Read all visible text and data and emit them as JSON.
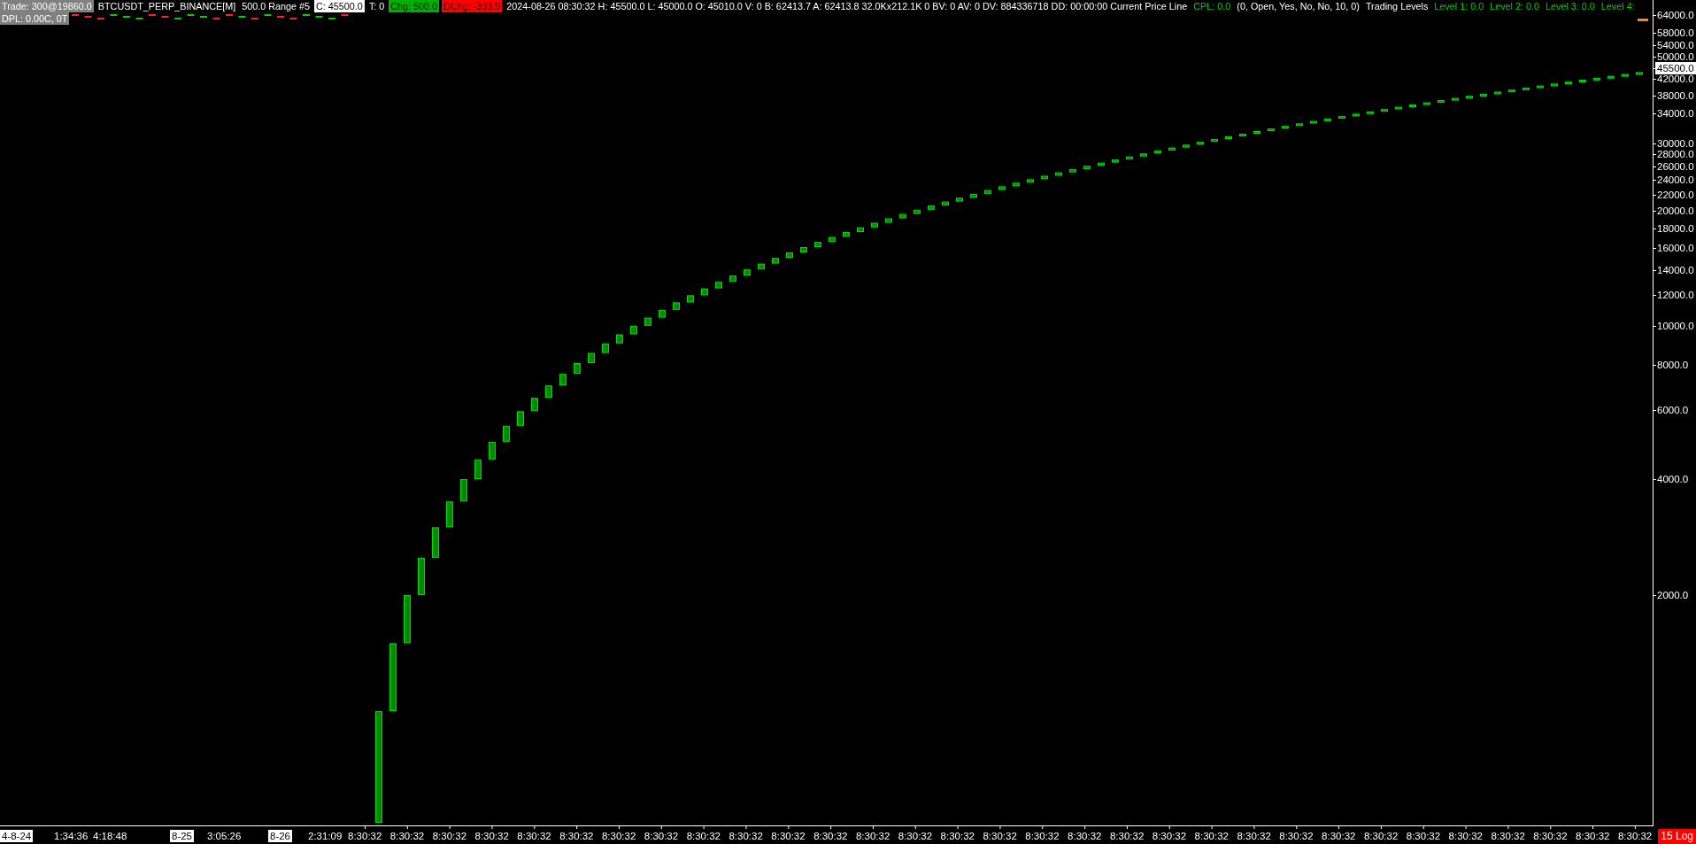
{
  "header": {
    "segments": [
      {
        "kind": "boxed-gray",
        "text": "Trade: 300@19860.0"
      },
      {
        "kind": "plain",
        "text": "BTCUSDT_PERP_BINANCE[M]"
      },
      {
        "kind": "plain",
        "text": "500.0 Range #5"
      },
      {
        "kind": "boxed-white",
        "text": "C: 45500.0"
      },
      {
        "kind": "plain",
        "text": "T: 0"
      },
      {
        "kind": "boxed-green",
        "text": "Chg: 500.0"
      },
      {
        "kind": "boxed-red",
        "text": "DChg: -393.9"
      },
      {
        "kind": "plain",
        "text": "2024-08-26 08:30:32 H: 45500.0 L: 45000.0 O: 45010.0 V: 0 B: 62413.7 A: 62413.8 32.0Kx212.1K 0 BV: 0 AV: 0 DV: 884336718 DD: 00:00:00 Current Price Line"
      },
      {
        "kind": "green",
        "text": "CPL: 0.0"
      },
      {
        "kind": "plain",
        "text": "(0, Open, Yes, No, No, 10, 0)"
      },
      {
        "kind": "plain",
        "text": "Trading Levels"
      },
      {
        "kind": "green",
        "text": "Level 1: 0.0"
      },
      {
        "kind": "green",
        "text": "Level 2: 0.0"
      },
      {
        "kind": "green",
        "text": "Level 3: 0.0"
      },
      {
        "kind": "green",
        "text": "Level 4:"
      }
    ],
    "second_line": "DPL: 0.00C, 0T"
  },
  "price_axis": [
    {
      "kind": "tick",
      "text": "64000.0"
    },
    {
      "kind": "tick",
      "text": "58000.0"
    },
    {
      "kind": "tick",
      "text": "54000.0"
    },
    {
      "kind": "tick",
      "text": "50000.0"
    },
    {
      "kind": "current",
      "text": "45500.0"
    },
    {
      "kind": "tick",
      "text": "42000.0"
    },
    {
      "kind": "tick",
      "text": "38000.0"
    },
    {
      "kind": "tick",
      "text": "34000.0"
    },
    {
      "kind": "tick",
      "text": "30000.0"
    },
    {
      "kind": "tick",
      "text": "28000.0"
    },
    {
      "kind": "tick",
      "text": "26000.0"
    },
    {
      "kind": "tick",
      "text": "24000.0"
    },
    {
      "kind": "tick",
      "text": "22000.0"
    },
    {
      "kind": "tick",
      "text": "20000.0"
    },
    {
      "kind": "tick",
      "text": "18000.0"
    },
    {
      "kind": "tick",
      "text": "16000.0"
    },
    {
      "kind": "tick",
      "text": "14000.0"
    },
    {
      "kind": "tick",
      "text": "12000.0"
    },
    {
      "kind": "tick",
      "text": "10000.0"
    },
    {
      "kind": "tick",
      "text": "8000.0"
    },
    {
      "kind": "tick",
      "text": "6000.0"
    },
    {
      "kind": "tick",
      "text": "4000.0"
    },
    {
      "kind": "tick",
      "text": "2000.0"
    }
  ],
  "time_axis": [
    {
      "kind": "date",
      "text": "4-8-24"
    },
    {
      "kind": "time",
      "text": "1:34:36"
    },
    {
      "kind": "time",
      "text": "4:18:48"
    },
    {
      "kind": "date",
      "text": "8-25"
    },
    {
      "kind": "time",
      "text": "3:05:26"
    },
    {
      "kind": "date",
      "text": "8-26"
    },
    {
      "kind": "time",
      "text": "2:31:09"
    },
    {
      "kind": "time",
      "text": "8:30:32"
    },
    {
      "kind": "time",
      "text": "8:30:32"
    },
    {
      "kind": "time",
      "text": "8:30:32"
    },
    {
      "kind": "time",
      "text": "8:30:32"
    },
    {
      "kind": "time",
      "text": "8:30:32"
    },
    {
      "kind": "time",
      "text": "8:30:32"
    },
    {
      "kind": "time",
      "text": "8:30:32"
    },
    {
      "kind": "time",
      "text": "8:30:32"
    },
    {
      "kind": "time",
      "text": "8:30:32"
    },
    {
      "kind": "time",
      "text": "8:30:32"
    },
    {
      "kind": "time",
      "text": "8:30:32"
    },
    {
      "kind": "time",
      "text": "8:30:32"
    },
    {
      "kind": "time",
      "text": "8:30:32"
    },
    {
      "kind": "time",
      "text": "8:30:32"
    },
    {
      "kind": "time",
      "text": "8:30:32"
    },
    {
      "kind": "time",
      "text": "8:30:32"
    },
    {
      "kind": "time",
      "text": "8:30:32"
    },
    {
      "kind": "time",
      "text": "8:30:32"
    },
    {
      "kind": "time",
      "text": "8:30:32"
    },
    {
      "kind": "time",
      "text": "8:30:32"
    },
    {
      "kind": "time",
      "text": "8:30:32"
    },
    {
      "kind": "time",
      "text": "8:30:32"
    },
    {
      "kind": "time",
      "text": "8:30:32"
    },
    {
      "kind": "time",
      "text": "8:30:32"
    },
    {
      "kind": "time",
      "text": "8:30:32"
    },
    {
      "kind": "time",
      "text": "8:30:32"
    },
    {
      "kind": "time",
      "text": "8:30:32"
    },
    {
      "kind": "time",
      "text": "8:30:32"
    },
    {
      "kind": "time",
      "text": "8:30:32"
    },
    {
      "kind": "time",
      "text": "8:30:32"
    },
    {
      "kind": "time",
      "text": "8:30:32"
    }
  ],
  "scale_mode": "15 Log"
}
